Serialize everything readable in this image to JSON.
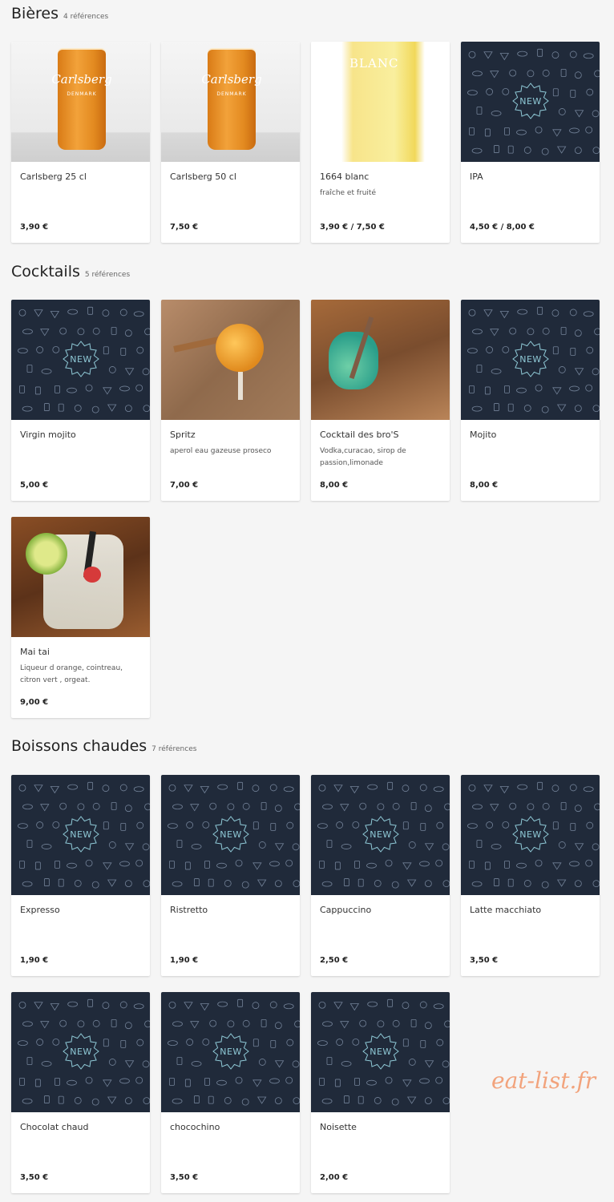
{
  "sections": [
    {
      "title": "Bières",
      "count": "4 références",
      "items": [
        {
          "name": "Carlsberg 25 cl",
          "desc": "",
          "price": "3,90 €",
          "photo_label": "Carlsberg",
          "photo_sub": "DENMARK"
        },
        {
          "name": "Carlsberg 50 cl",
          "desc": "",
          "price": "7,50 €",
          "photo_label": "Carlsberg",
          "photo_sub": "DENMARK"
        },
        {
          "name": "1664 blanc",
          "desc": "fraîche et fruité",
          "price": "3,90 € / 7,50 €",
          "photo_label": "BLANC"
        },
        {
          "name": "IPA",
          "desc": "",
          "price": "4,50 € / 8,00 €",
          "badge": "NEW"
        }
      ]
    },
    {
      "title": "Cocktails",
      "count": "5 références",
      "items": [
        {
          "name": "Virgin mojito",
          "desc": "",
          "price": "5,00 €",
          "badge": "NEW"
        },
        {
          "name": "Spritz",
          "desc": "aperol eau gazeuse proseco",
          "price": "7,00 €"
        },
        {
          "name": "Cocktail des bro'S",
          "desc": "Vodka,curacao, sirop de passion,limonade",
          "price": "8,00 €"
        },
        {
          "name": "Mojito",
          "desc": "",
          "price": "8,00 €",
          "badge": "NEW"
        },
        {
          "name": "Mai tai",
          "desc": "Liqueur d orange, cointreau, citron vert , orgeat.",
          "price": "9,00 €"
        }
      ]
    },
    {
      "title": "Boissons chaudes",
      "count": "7 références",
      "items": [
        {
          "name": "Expresso",
          "desc": "",
          "price": "1,90 €",
          "badge": "NEW"
        },
        {
          "name": "Ristretto",
          "desc": "",
          "price": "1,90 €",
          "badge": "NEW"
        },
        {
          "name": "Cappuccino",
          "desc": "",
          "price": "2,50 €",
          "badge": "NEW"
        },
        {
          "name": "Latte macchiato",
          "desc": "",
          "price": "3,50 €",
          "badge": "NEW"
        },
        {
          "name": "Chocolat chaud",
          "desc": "",
          "price": "3,50 €",
          "badge": "NEW"
        },
        {
          "name": "chocochino",
          "desc": "",
          "price": "3,50 €",
          "badge": "NEW"
        },
        {
          "name": "Noisette",
          "desc": "",
          "price": "2,00 €",
          "badge": "NEW"
        }
      ]
    }
  ],
  "watermark": "eat-list.fr",
  "colors": {
    "placeholder_bg": "#202a3a",
    "pattern_line": "#8fa0b8",
    "badge_text": "#8fc9d6",
    "watermark": "#f2a37c"
  }
}
